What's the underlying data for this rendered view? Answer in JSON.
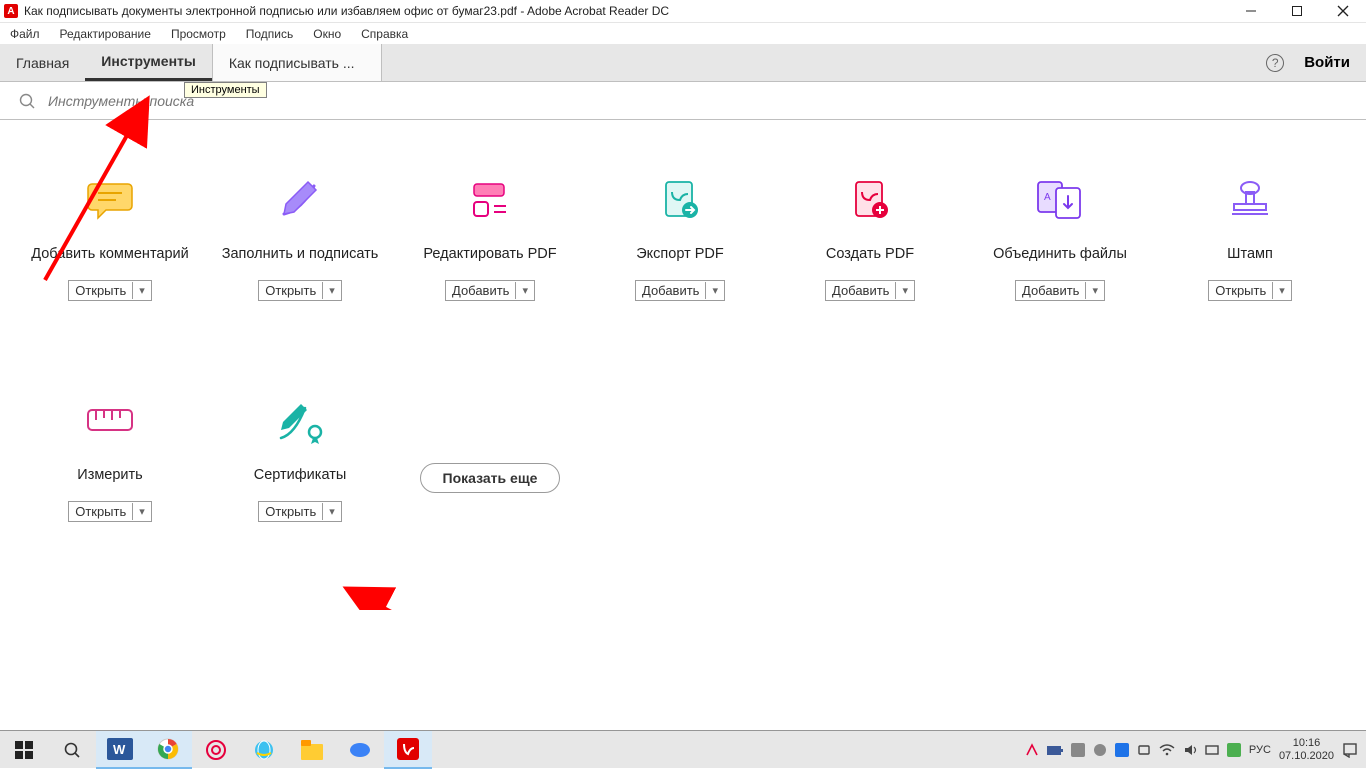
{
  "titlebar": {
    "title": "Как подписывать документы электронной подписью или избавляем офис от бумаг23.pdf - Adobe Acrobat Reader DC"
  },
  "menubar": {
    "file": "Файл",
    "edit": "Редактирование",
    "view": "Просмотр",
    "sign": "Подпись",
    "window": "Окно",
    "help": "Справка"
  },
  "tabs": {
    "home": "Главная",
    "tools": "Инструменты",
    "doc": "Как подписывать ...",
    "signin": "Войти"
  },
  "tooltip": "Инструменты",
  "search": {
    "placeholder": "Инструменты поиска"
  },
  "tools_grid": {
    "row1": [
      {
        "label": "Добавить комментарий",
        "btn": "Открыть"
      },
      {
        "label": "Заполнить и подписать",
        "btn": "Открыть"
      },
      {
        "label": "Редактировать PDF",
        "btn": "Добавить"
      },
      {
        "label": "Экспорт PDF",
        "btn": "Добавить"
      },
      {
        "label": "Создать PDF",
        "btn": "Добавить"
      },
      {
        "label": "Объединить файлы",
        "btn": "Добавить"
      },
      {
        "label": "Штамп",
        "btn": "Открыть"
      }
    ],
    "row2": [
      {
        "label": "Измерить",
        "btn": "Открыть"
      },
      {
        "label": "Сертификаты",
        "btn": "Открыть"
      }
    ],
    "show_more": "Показать еще"
  },
  "taskbar": {
    "lang": "РУС",
    "time": "10:16",
    "date": "07.10.2020"
  }
}
